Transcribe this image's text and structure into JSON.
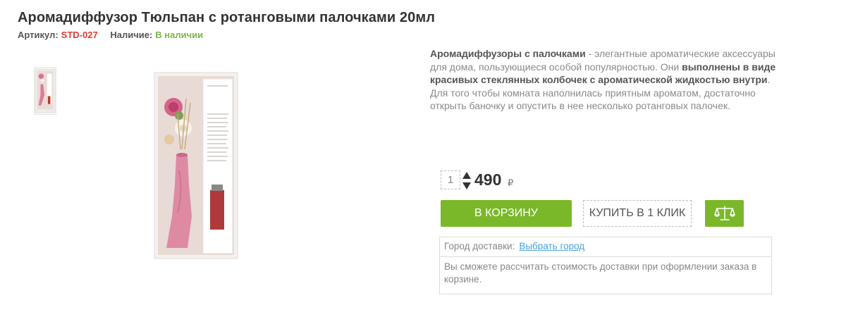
{
  "product": {
    "title": "Аромадиффузор Тюльпан с ротанговыми палочками 20мл",
    "sku_label": "Артикул:",
    "sku_value": "STD-027",
    "stock_label": "Наличие:",
    "stock_value": "В наличии"
  },
  "description": {
    "p1_bold": "Аромадиффузоры с палочками",
    "p1_text": " - элегантные ароматические аксессуары для дома, пользующиеся особой популярностью. Они ",
    "p2_bold": "выполнены в виде красивых стеклянных колбочек с ароматической жидкостью внутри",
    "p2_text": ". Для того чтобы комната наполнилась приятным ароматом, достаточно открыть баночку и опустить в нее несколько ротанговых палочек."
  },
  "purchase": {
    "quantity": "1",
    "price": "490",
    "currency": "₽",
    "cart_label": "В КОРЗИНУ",
    "oneclick_label": "КУПИТЬ В 1 КЛИК"
  },
  "delivery": {
    "city_label": "Город доставки:",
    "city_link": "Выбрать город",
    "note": "Вы сможете рассчитать стоимость доставки при оформлении заказа в корзине."
  },
  "icons": {
    "compare": "scales-icon",
    "quantity_arrows": "up-down-arrows-icon"
  },
  "colors": {
    "accent_green": "#7ab829",
    "sku_red": "#e53935",
    "stock_green": "#7ab648",
    "link_blue": "#4aa3df"
  }
}
